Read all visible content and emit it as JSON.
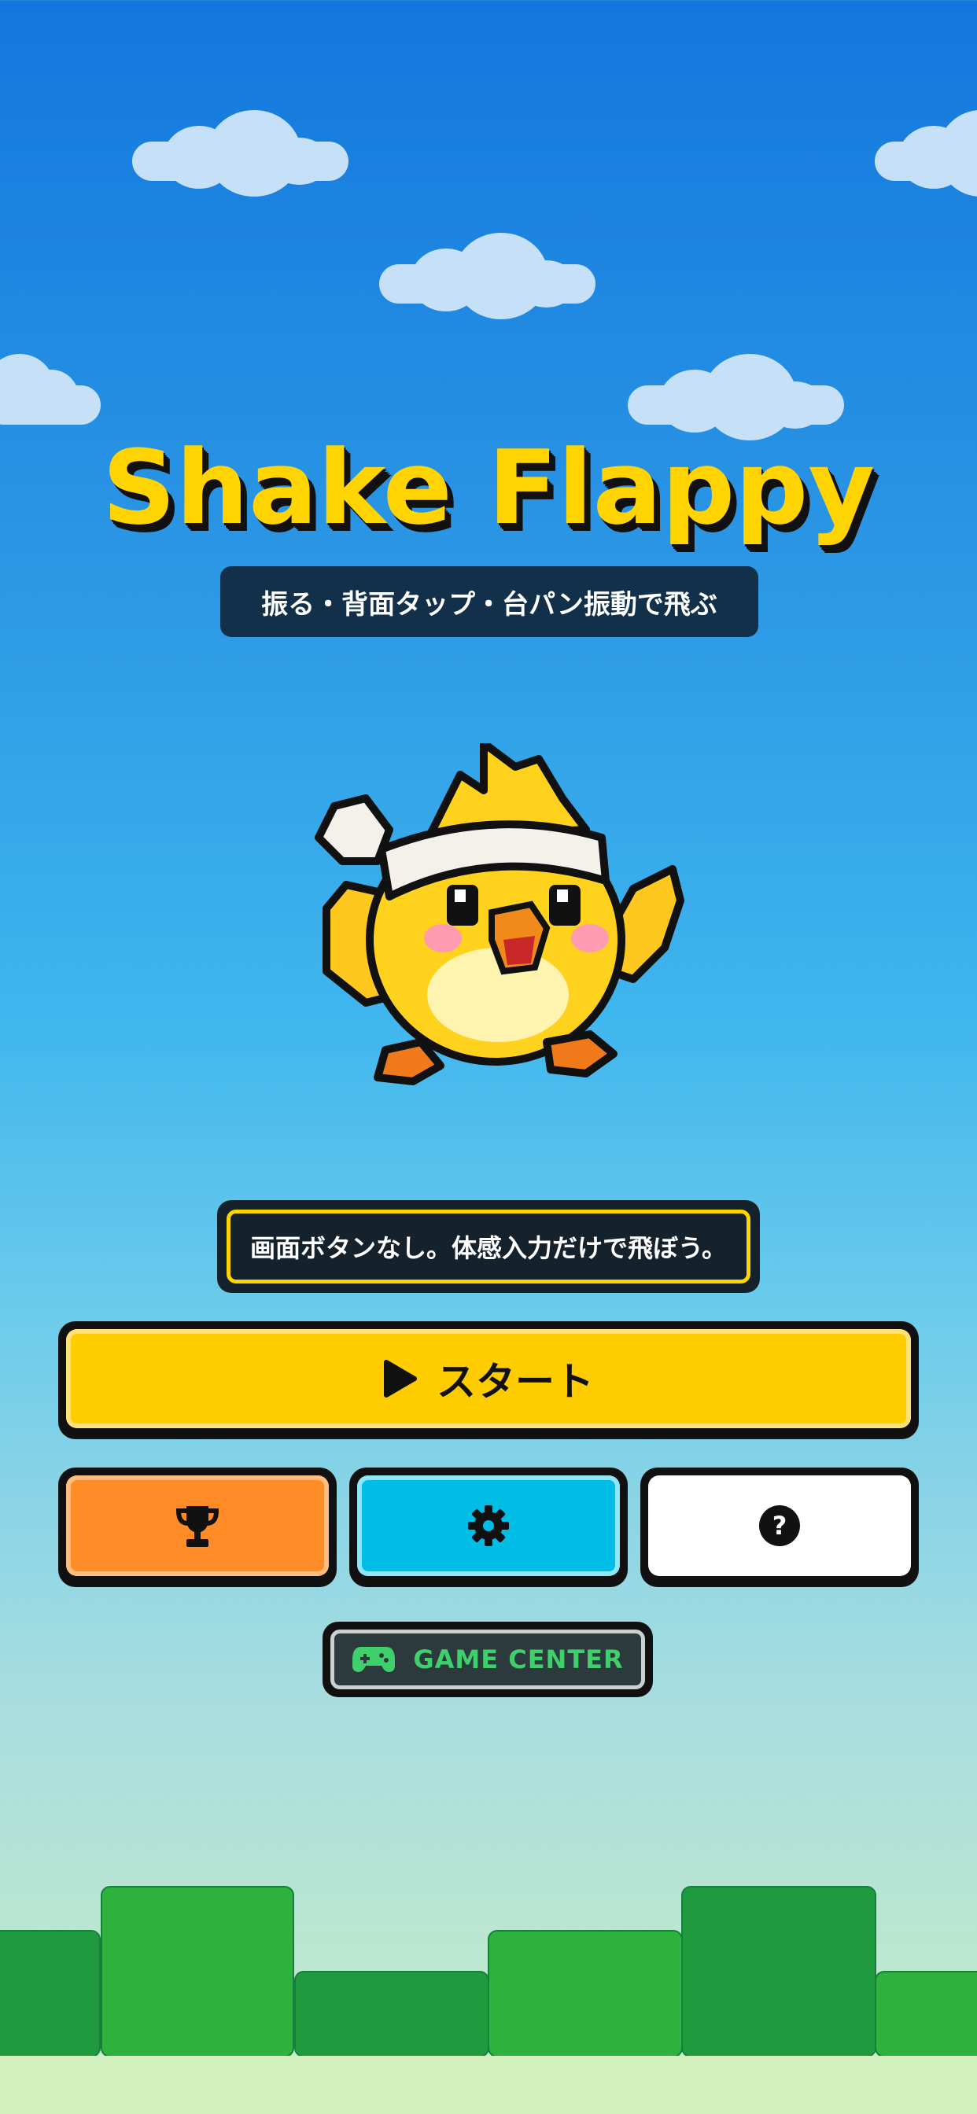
{
  "game": {
    "title": "Shake Flappy",
    "subtitle": "振る・背面タップ・台パン振動で飛ぶ",
    "hint": "画面ボタンなし。体感入力だけで飛ぼう。"
  },
  "buttons": {
    "start_label": "スタート",
    "leaderboard_icon": "trophy-icon",
    "settings_icon": "gear-icon",
    "help_icon": "question-icon",
    "game_center_label": "GAME CENTER"
  },
  "colors": {
    "title": "#ffd400",
    "start": "#ffcc00",
    "leaderboard": "#ff8c26",
    "settings": "#00bde6",
    "help": "#ffffff",
    "game_center_text": "#3fd06b",
    "ground_green": "#2eb13d"
  }
}
